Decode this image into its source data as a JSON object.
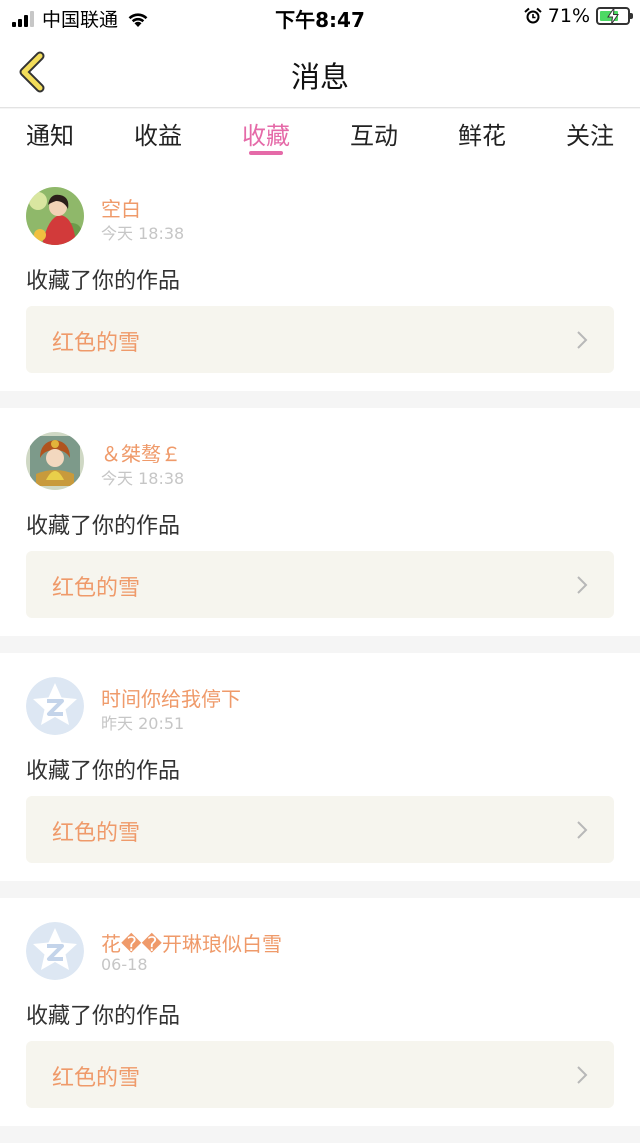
{
  "status_bar": {
    "carrier": "中国联通",
    "time": "下午8:47",
    "battery_percent": "71%",
    "battery_level": 0.71
  },
  "nav": {
    "title": "消息"
  },
  "tabs": [
    {
      "label": "通知",
      "active": false
    },
    {
      "label": "收益",
      "active": false
    },
    {
      "label": "收藏",
      "active": true
    },
    {
      "label": "互动",
      "active": false
    },
    {
      "label": "鲜花",
      "active": false
    },
    {
      "label": "关注",
      "active": false
    }
  ],
  "colors": {
    "accent": "#e56aa8",
    "username": "#ef9a6a",
    "work_box": "#f6f5ee"
  },
  "notifications": [
    {
      "username": "空白",
      "time": "今天 18:38",
      "action": "收藏了你的作品",
      "work_title": "红色的雪",
      "avatar": "avatar-photo-girl"
    },
    {
      "username": "＆桀骜￡",
      "time": "今天 18:38",
      "action": "收藏了你的作品",
      "work_title": "红色的雪",
      "avatar": "avatar-photo-figure"
    },
    {
      "username": "时间你给我停下",
      "time": "昨天 20:51",
      "action": "收藏了你的作品",
      "work_title": "红色的雪",
      "avatar": "default-avatar-icon"
    },
    {
      "username": "花��开琳琅似白雪",
      "time": "06-18",
      "action": "收藏了你的作品",
      "work_title": "红色的雪",
      "avatar": "default-avatar-icon"
    }
  ]
}
